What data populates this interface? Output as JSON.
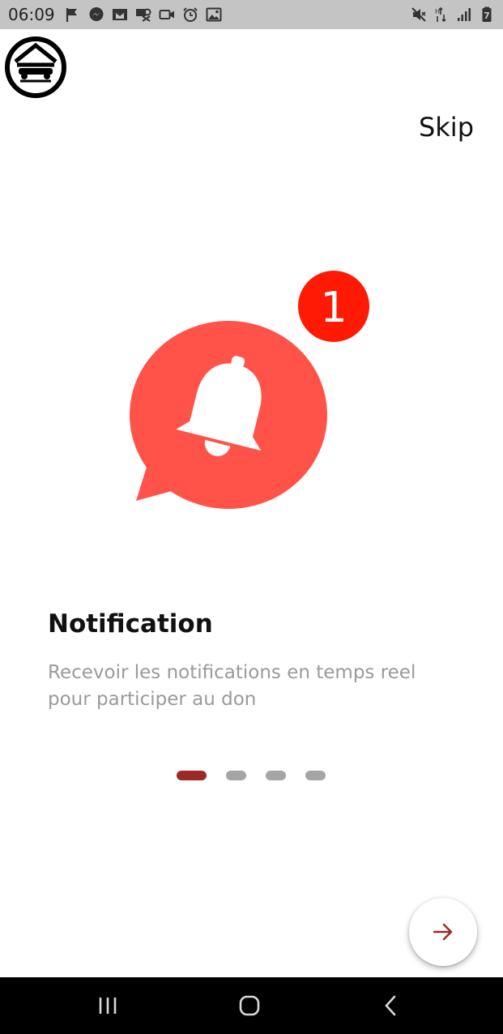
{
  "status_bar": {
    "time": "06:09",
    "left_icons": [
      "flag-icon",
      "messenger-icon",
      "gmail-icon",
      "data-saver-icon",
      "video-icon",
      "alarm-icon",
      "gallery-icon"
    ],
    "right_icons": [
      "mute-icon",
      "data-arrows-icon",
      "signal-icon",
      "battery-icon"
    ],
    "battery_level": "7"
  },
  "header": {
    "skip_label": "Skip"
  },
  "illustration": {
    "badge_count": "1",
    "bubble_color": "#ff5349",
    "badge_color": "#ff1a06"
  },
  "slide": {
    "title": "Notification",
    "description": "Recevoir les notifications en temps reel pour participer au don"
  },
  "pager": {
    "total": 4,
    "active_index": 0,
    "active_color": "#9b2a24",
    "inactive_color": "#a5a5a5"
  },
  "next_button": {
    "icon": "arrow-right-icon",
    "color": "#9b2a24"
  },
  "nav_bar": {
    "buttons": [
      "recents-icon",
      "home-icon",
      "back-icon"
    ]
  }
}
